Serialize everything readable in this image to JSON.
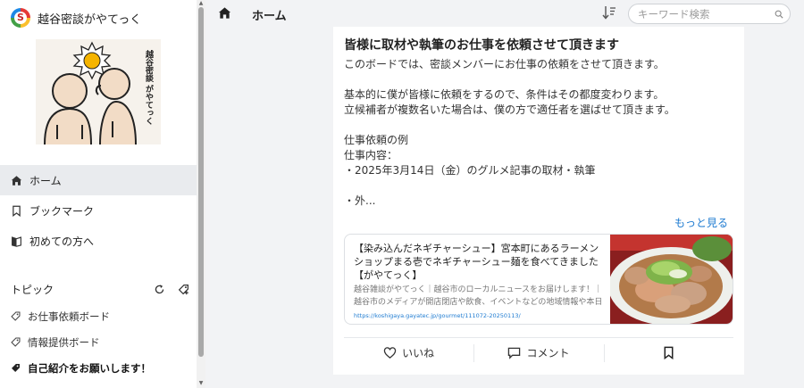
{
  "brand": {
    "name": "越谷密談がやてっく"
  },
  "community_art": {
    "vertical_text": "越谷密談 がやてっく"
  },
  "nav": [
    {
      "label": "ホーム",
      "icon": "home-icon",
      "active": true
    },
    {
      "label": "ブックマーク",
      "icon": "bookmark-icon",
      "active": false
    },
    {
      "label": "初めての方へ",
      "icon": "book-icon",
      "active": false
    }
  ],
  "topics": {
    "heading": "トピック",
    "items": [
      {
        "label": "お仕事依頼ボード",
        "bold": false
      },
      {
        "label": "情報提供ボード",
        "bold": false
      },
      {
        "label": "自己紹介をお願いします！",
        "bold": true
      }
    ]
  },
  "header": {
    "title": "ホーム",
    "search_placeholder": "キーワード検索"
  },
  "post": {
    "title": "皆様に取材や執筆のお仕事を依頼させて頂きます",
    "body": [
      "このボードでは、密談メンバーにお仕事の依頼をさせて頂きます。",
      "",
      "基本的に僕が皆様に依頼をするので、条件はその都度変わります。",
      "立候補者が複数名いた場合は、僕の方で適任者を選ばせて頂きます。",
      "",
      "仕事依頼の例",
      "仕事内容：",
      "・2025年3月14日（金）のグルメ記事の取材・執筆",
      "",
      "・外..."
    ],
    "more_label": "もっと見る",
    "link_card": {
      "title": "【染み込んだネギチャーシュー】宮本町にあるラーメンショップまる壱でネギチャーシュー麺を食べてきました【がやてっく】",
      "description": "越谷雑談がやてっく｜越谷市のローカルニュースをお届けします！｜越谷市のメディアが開店閉店や飲食、イベントなどの地域情報や本日の最新情報をお届けします",
      "url": "https://koshigaya.gayatec.jp/gourmet/111072-20250113/"
    },
    "actions": {
      "like_label": "いいね",
      "comment_label": "コメント"
    }
  },
  "colors": {
    "accent_link": "#1e7bd1",
    "active_nav_bg": "#e9ebee",
    "page_bg": "#f2f3f5"
  }
}
